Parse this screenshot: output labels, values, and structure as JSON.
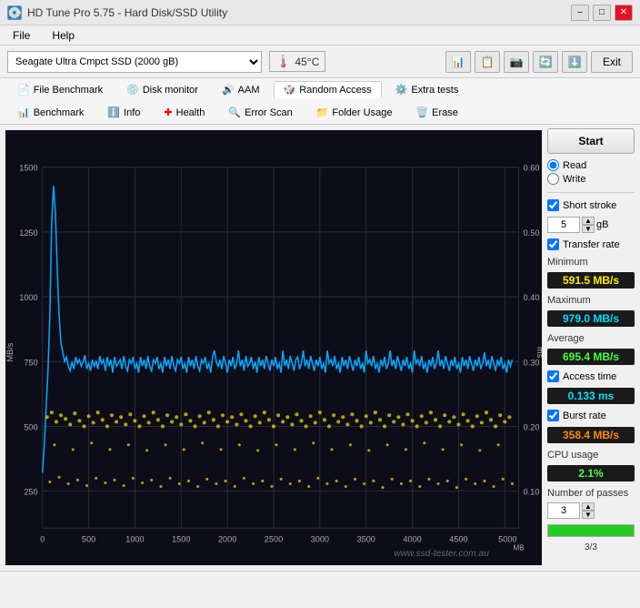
{
  "titleBar": {
    "title": "HD Tune Pro 5.75 - Hard Disk/SSD Utility",
    "icon": "💽",
    "minimizeBtn": "–",
    "maximizeBtn": "□",
    "closeBtn": "✕"
  },
  "menuBar": {
    "items": [
      "File",
      "Help"
    ]
  },
  "toolbar": {
    "deviceName": "Seagate Ultra Cmpct SSD (2000 gB)",
    "temperature": "45°C",
    "exitLabel": "Exit"
  },
  "tabs": {
    "row1": [
      {
        "label": "File Benchmark",
        "icon": "📄"
      },
      {
        "label": "Disk monitor",
        "icon": "💿"
      },
      {
        "label": "AAM",
        "icon": "🔊"
      },
      {
        "label": "Random Access",
        "icon": "🎲",
        "active": true
      },
      {
        "label": "Extra tests",
        "icon": "⚙️"
      }
    ],
    "row2": [
      {
        "label": "Benchmark",
        "icon": "📊"
      },
      {
        "label": "Info",
        "icon": "ℹ️"
      },
      {
        "label": "Health",
        "icon": "➕"
      },
      {
        "label": "Error Scan",
        "icon": "🔍"
      },
      {
        "label": "Folder Usage",
        "icon": "📁"
      },
      {
        "label": "Erase",
        "icon": "🗑️"
      }
    ]
  },
  "chart": {
    "yAxisLeftLabel": "MB/s",
    "yAxisRightLabel": "ms",
    "yMaxLeft": 1500,
    "yMaxRight": 0.6,
    "xAxisLabel": "MB",
    "xTicks": [
      "0",
      "500",
      "1000",
      "1500",
      "2000",
      "2500",
      "3000",
      "3500",
      "4000",
      "4500",
      "5000"
    ],
    "yTicksLeft": [
      "1500",
      "1250",
      "1000",
      "750",
      "500",
      "250"
    ],
    "yTicksRight": [
      "0.60",
      "0.50",
      "0.40",
      "0.30",
      "0.20",
      "0.10"
    ],
    "watermark": "www.ssd-tester.com.au"
  },
  "rightPanel": {
    "startLabel": "Start",
    "readLabel": "Read",
    "writeLabel": "Write",
    "shortStrokeLabel": "Short stroke",
    "shortStrokeValue": "5",
    "shortStrokeUnit": "gB",
    "transferRateLabel": "Transfer rate",
    "minimumLabel": "Minimum",
    "minimumValue": "591.5 MB/s",
    "maximumLabel": "Maximum",
    "maximumValue": "979.0 MB/s",
    "averageLabel": "Average",
    "averageValue": "695.4 MB/s",
    "accessTimeLabel": "Access time",
    "accessTimeValue": "0.133 ms",
    "burstRateLabel": "Burst rate",
    "burstRateValue": "358.4 MB/s",
    "cpuUsageLabel": "CPU usage",
    "cpuUsageValue": "2.1%",
    "passesLabel": "Number of passes",
    "passesValue": "3",
    "passesProgress": "3/3",
    "progressPercent": 100
  }
}
